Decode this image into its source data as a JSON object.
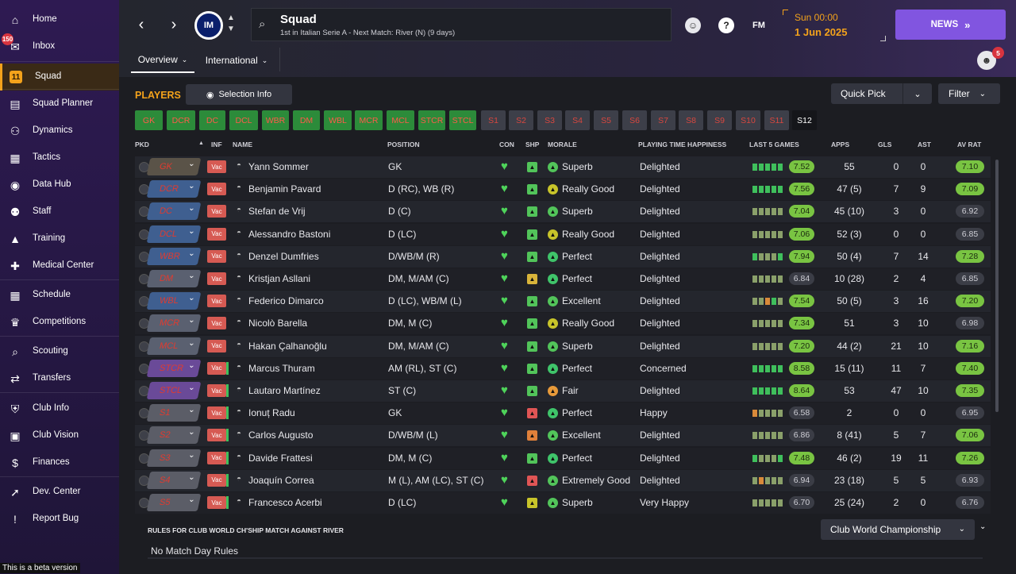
{
  "sidebar": {
    "items": [
      {
        "label": "Home",
        "icon": "home-icon",
        "glyph": "⌂"
      },
      {
        "label": "Inbox",
        "icon": "inbox-icon",
        "glyph": "✉",
        "badge": "150"
      },
      {
        "label": "Squad",
        "icon": "squad-icon",
        "glyph": "11"
      },
      {
        "label": "Squad Planner",
        "icon": "clipboard-icon",
        "glyph": "▤"
      },
      {
        "label": "Dynamics",
        "icon": "dynamics-icon",
        "glyph": "⚇"
      },
      {
        "label": "Tactics",
        "icon": "tactics-icon",
        "glyph": "▦"
      },
      {
        "label": "Data Hub",
        "icon": "data-hub-icon",
        "glyph": "◉"
      },
      {
        "label": "Staff",
        "icon": "staff-icon",
        "glyph": "⚉"
      },
      {
        "label": "Training",
        "icon": "training-icon",
        "glyph": "▲"
      },
      {
        "label": "Medical Center",
        "icon": "medical-icon",
        "glyph": "✚"
      },
      {
        "label": "Schedule",
        "icon": "schedule-icon",
        "glyph": "▦"
      },
      {
        "label": "Competitions",
        "icon": "trophy-icon",
        "glyph": "♛"
      },
      {
        "label": "Scouting",
        "icon": "scouting-icon",
        "glyph": "⌕"
      },
      {
        "label": "Transfers",
        "icon": "transfers-icon",
        "glyph": "⇄"
      },
      {
        "label": "Club Info",
        "icon": "club-info-icon",
        "glyph": "⛨"
      },
      {
        "label": "Club Vision",
        "icon": "club-vision-icon",
        "glyph": "▣"
      },
      {
        "label": "Finances",
        "icon": "finances-icon",
        "glyph": "$"
      },
      {
        "label": "Dev. Center",
        "icon": "dev-center-icon",
        "glyph": "➚"
      },
      {
        "label": "Report Bug",
        "icon": "report-bug-icon",
        "glyph": "!"
      }
    ],
    "beta_text": "This is a beta version"
  },
  "header": {
    "crest_text": "IM",
    "title": "Squad",
    "subtitle": "1st in Italian Serie A - Next Match: River (N) (9 days)",
    "date_time": "Sun 00:00",
    "date": "1 Jun 2025",
    "fm_label": "FM",
    "help_label": "?",
    "news_label": "NEWS",
    "manager_badge": "5",
    "tabs": [
      {
        "label": "Overview"
      },
      {
        "label": "International"
      }
    ]
  },
  "players_section": {
    "title": "PLAYERS",
    "selection_info_label": "Selection Info",
    "quick_pick_label": "Quick Pick",
    "filter_label": "Filter",
    "position_tabs": [
      "GK",
      "DCR",
      "DC",
      "DCL",
      "WBR",
      "DM",
      "WBL",
      "MCR",
      "MCL",
      "STCR",
      "STCL",
      "S1",
      "S2",
      "S3",
      "S4",
      "S5",
      "S6",
      "S7",
      "S8",
      "S9",
      "S10",
      "S11",
      "S12"
    ]
  },
  "table": {
    "headers": {
      "pkd": "PKD",
      "inf": "INF",
      "name": "NAME",
      "position": "POSITION",
      "con": "CON",
      "shp": "SHP",
      "morale": "MORALE",
      "pth": "PLAYING TIME HAPPINESS",
      "last5": "LAST 5 GAMES",
      "apps": "APPS",
      "gls": "GLS",
      "ast": "AST",
      "avrat": "AV RAT"
    },
    "rows": [
      {
        "pkd": "GK",
        "inf": "Vac",
        "name": "Yann Sommer",
        "position": "GK",
        "morale": "Superb",
        "pth": "Delighted",
        "last5_avg": "7.52",
        "apps": "55",
        "gls": "0",
        "ast": "0",
        "avrat": "7.10"
      },
      {
        "pkd": "DCR",
        "inf": "Vac",
        "name": "Benjamin Pavard",
        "position": "D (RC), WB (R)",
        "morale": "Really Good",
        "pth": "Delighted",
        "last5_avg": "7.56",
        "apps": "47 (5)",
        "gls": "7",
        "ast": "9",
        "avrat": "7.09"
      },
      {
        "pkd": "DC",
        "inf": "Vac",
        "name": "Stefan de Vrij",
        "position": "D (C)",
        "morale": "Superb",
        "pth": "Delighted",
        "last5_avg": "7.04",
        "apps": "45 (10)",
        "gls": "3",
        "ast": "0",
        "avrat": "6.92"
      },
      {
        "pkd": "DCL",
        "inf": "Vac",
        "name": "Alessandro Bastoni",
        "position": "D (LC)",
        "morale": "Really Good",
        "pth": "Delighted",
        "last5_avg": "7.06",
        "apps": "52 (3)",
        "gls": "0",
        "ast": "0",
        "avrat": "6.85"
      },
      {
        "pkd": "WBR",
        "inf": "Vac",
        "name": "Denzel Dumfries",
        "position": "D/WB/M (R)",
        "morale": "Perfect",
        "pth": "Delighted",
        "last5_avg": "7.94",
        "apps": "50 (4)",
        "gls": "7",
        "ast": "14",
        "avrat": "7.28"
      },
      {
        "pkd": "DM",
        "inf": "Vac",
        "name": "Kristjan Asllani",
        "position": "DM, M/AM (C)",
        "morale": "Perfect",
        "pth": "Delighted",
        "last5_avg": "6.84",
        "apps": "10 (28)",
        "gls": "2",
        "ast": "4",
        "avrat": "6.85"
      },
      {
        "pkd": "WBL",
        "inf": "Vac",
        "name": "Federico Dimarco",
        "position": "D (LC), WB/M (L)",
        "morale": "Excellent",
        "pth": "Delighted",
        "last5_avg": "7.54",
        "apps": "50 (5)",
        "gls": "3",
        "ast": "16",
        "avrat": "7.20"
      },
      {
        "pkd": "MCR",
        "inf": "Vac",
        "name": "Nicolò Barella",
        "position": "DM, M (C)",
        "morale": "Really Good",
        "pth": "Delighted",
        "last5_avg": "7.34",
        "apps": "51",
        "gls": "3",
        "ast": "10",
        "avrat": "6.98"
      },
      {
        "pkd": "MCL",
        "inf": "Vac",
        "name": "Hakan Çalhanoğlu",
        "position": "DM, M/AM (C)",
        "morale": "Superb",
        "pth": "Delighted",
        "last5_avg": "7.20",
        "apps": "44 (2)",
        "gls": "21",
        "ast": "10",
        "avrat": "7.16"
      },
      {
        "pkd": "STCR",
        "inf": "Vac",
        "name": "Marcus Thuram",
        "position": "AM (RL), ST (C)",
        "morale": "Perfect",
        "pth": "Concerned",
        "last5_avg": "8.58",
        "apps": "15 (11)",
        "gls": "11",
        "ast": "7",
        "avrat": "7.40"
      },
      {
        "pkd": "STCL",
        "inf": "Vac",
        "name": "Lautaro Martínez",
        "position": "ST (C)",
        "morale": "Fair",
        "pth": "Delighted",
        "last5_avg": "8.64",
        "apps": "53",
        "gls": "47",
        "ast": "10",
        "avrat": "7.35"
      },
      {
        "pkd": "S1",
        "inf": "Vac",
        "name": "Ionuț Radu",
        "position": "GK",
        "morale": "Perfect",
        "pth": "Happy",
        "last5_avg": "6.58",
        "apps": "2",
        "gls": "0",
        "ast": "0",
        "avrat": "6.95"
      },
      {
        "pkd": "S2",
        "inf": "Vac",
        "name": "Carlos Augusto",
        "position": "D/WB/M (L)",
        "morale": "Excellent",
        "pth": "Delighted",
        "last5_avg": "6.86",
        "apps": "8 (41)",
        "gls": "5",
        "ast": "7",
        "avrat": "7.06"
      },
      {
        "pkd": "S3",
        "inf": "Vac",
        "name": "Davide Frattesi",
        "position": "DM, M (C)",
        "morale": "Perfect",
        "pth": "Delighted",
        "last5_avg": "7.48",
        "apps": "46 (2)",
        "gls": "19",
        "ast": "11",
        "avrat": "7.26"
      },
      {
        "pkd": "S4",
        "inf": "Vac",
        "name": "Joaquín Correa",
        "position": "M (L), AM (LC), ST (C)",
        "morale": "Extremely Good",
        "pth": "Delighted",
        "last5_avg": "6.94",
        "apps": "23 (18)",
        "gls": "5",
        "ast": "5",
        "avrat": "6.93"
      },
      {
        "pkd": "S5",
        "inf": "Vac",
        "name": "Francesco Acerbi",
        "position": "D (LC)",
        "morale": "Superb",
        "pth": "Very Happy",
        "last5_avg": "6.70",
        "apps": "25 (24)",
        "gls": "2",
        "ast": "0",
        "avrat": "6.76"
      }
    ]
  },
  "rules": {
    "title": "RULES FOR CLUB WORLD CH'SHIP MATCH AGAINST RIVER",
    "text": "No Match Day Rules",
    "competition": "Club World Championship"
  }
}
